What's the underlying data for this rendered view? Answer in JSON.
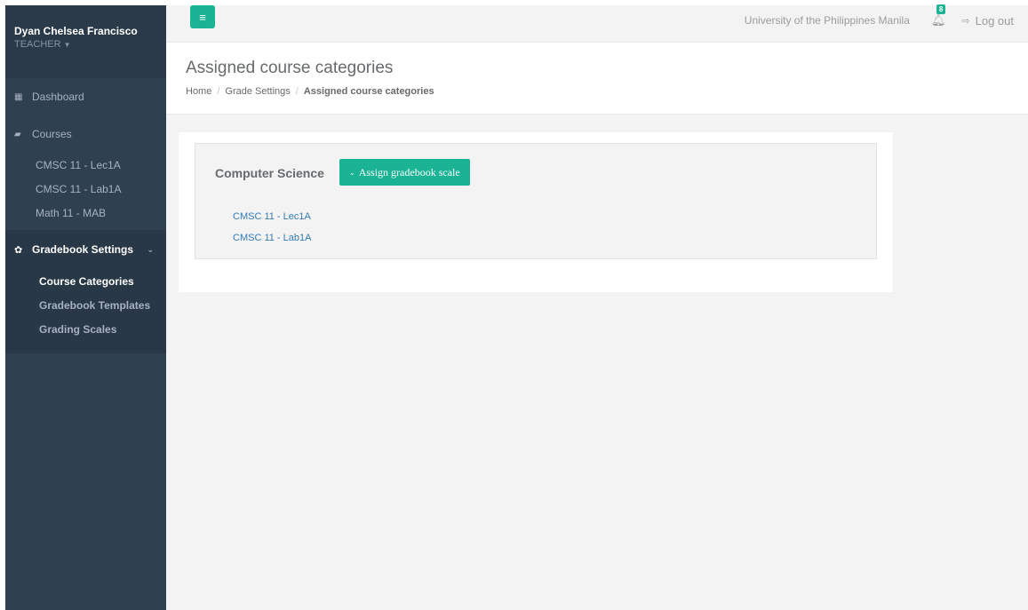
{
  "sidebar": {
    "user_name": "Dyan Chelsea Francisco",
    "user_role": "TEACHER",
    "role_caret_icon": "caret-down-icon",
    "dashboard_label": "Dashboard",
    "dashboard_icon": "grid-icon",
    "courses_label": "Courses",
    "courses_icon": "book-icon",
    "courses": [
      {
        "label": "CMSC 11 - Lec1A"
      },
      {
        "label": "CMSC 11 - Lab1A"
      },
      {
        "label": "Math 11 - MAB"
      }
    ],
    "gradebook_label": "Gradebook Settings",
    "gradebook_icon": "gear-icon",
    "gradebook_items": [
      {
        "label": "Course Categories",
        "active": true
      },
      {
        "label": "Gradebook Templates",
        "active": false
      },
      {
        "label": "Grading Scales",
        "active": false
      }
    ]
  },
  "topbar": {
    "menu_icon": "hamburger-menu-icon",
    "university": "University of the Philippines Manila",
    "notification_icon": "bell-icon",
    "notification_count": "8",
    "logout_icon": "sign-out-icon",
    "logout_label": "Log out"
  },
  "heading": {
    "title": "Assigned course categories",
    "breadcrumb": [
      "Home",
      "Grade Settings",
      "Assigned course categories"
    ]
  },
  "category": {
    "name": "Computer Science",
    "assign_button_label": "Assign gradebook scale",
    "assign_button_icon": "chevron-down-icon",
    "courses": [
      {
        "label": "CMSC 11 - Lec1A"
      },
      {
        "label": "CMSC 11 - Lab1A"
      }
    ]
  },
  "colors": {
    "accent": "#1ab394",
    "sidebar_bg": "#2f4050",
    "link": "#337ab7"
  }
}
